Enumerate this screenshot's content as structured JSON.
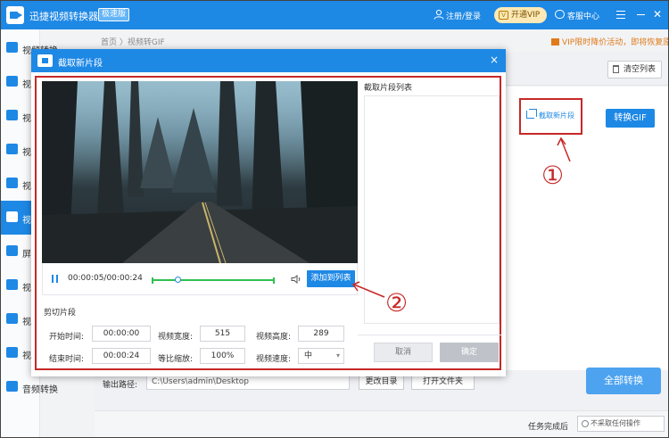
{
  "app": {
    "name": "迅捷视频转换器",
    "edition": "极速版",
    "user_link": "注册/登录",
    "vip_button": "开通VIP",
    "vip_badge": "V",
    "service_link": "客服中心"
  },
  "sidebar": {
    "items": [
      {
        "label": "视频转换",
        "icon": "video-convert-icon",
        "active": false
      },
      {
        "label": "视",
        "icon": "video-audio-icon",
        "active": false
      },
      {
        "label": "视",
        "icon": "video-split-icon",
        "active": false
      },
      {
        "label": "视",
        "icon": "video-merge-icon",
        "active": false
      },
      {
        "label": "视",
        "icon": "video-compress-icon",
        "active": false
      },
      {
        "label": "视",
        "icon": "video-gif-icon",
        "active": true
      },
      {
        "label": "屏",
        "icon": "screen-record-icon",
        "active": false
      },
      {
        "label": "视",
        "icon": "video-watermark-icon",
        "active": false
      },
      {
        "label": "视",
        "icon": "video-subtitle-icon",
        "active": false
      },
      {
        "label": "视",
        "icon": "video-music-icon",
        "active": false
      },
      {
        "label": "音频转换",
        "icon": "audio-convert-icon",
        "active": false
      }
    ]
  },
  "main": {
    "breadcrumb": "首页 〉视频转GIF",
    "promo": "VIP限时降价活动，即将恢复原价",
    "clear_list": "清空列表",
    "clip_link": "截取新片段",
    "to_gif": "转换GIF",
    "output_label": "输出路径:",
    "output_path": "C:\\Users\\admin\\Desktop",
    "change_dir": "更改目录",
    "open_folder": "打开文件夹",
    "convert_all": "全部转换",
    "after_label": "任务完成后",
    "after_value": "不采取任何操作"
  },
  "dialog": {
    "title": "截取新片段",
    "close": "×",
    "time": "00:00:05/00:00:24",
    "add_to_list": "添加到列表",
    "clip_heading": "剪切片段",
    "start_label": "开始时间:",
    "start_value": "00:00:00",
    "end_label": "结束时间:",
    "end_value": "00:00:24",
    "width_label": "视频宽度:",
    "width_value": "515",
    "ratio_label": "等比缩放:",
    "ratio_value": "100%",
    "height_label": "视频高度:",
    "height_value": "289",
    "speed_label": "视频速度:",
    "speed_value": "中",
    "list_title": "截取片段列表",
    "cancel": "取消",
    "ok": "确定",
    "playhead_fraction": 0.21
  },
  "annotations": {
    "one": "①",
    "two": "②"
  },
  "colors": {
    "accent": "#1e88e5",
    "annotation": "#c62828",
    "range": "#2fbf4f"
  }
}
